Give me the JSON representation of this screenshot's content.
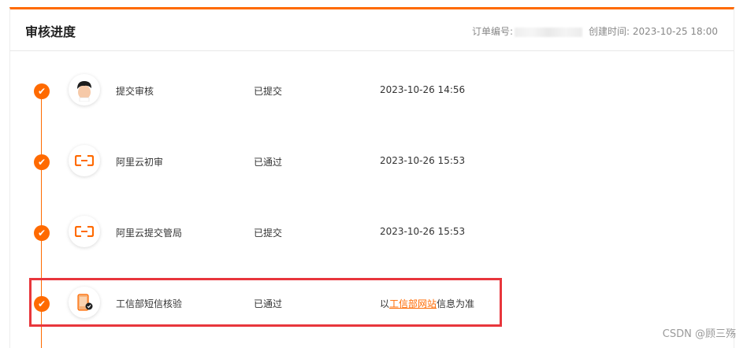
{
  "header": {
    "title": "审核进度",
    "order_label": "订单编号:",
    "created_label": "创建时间: 2023-10-25 18:00"
  },
  "steps": [
    {
      "name": "提交审核",
      "status": "已提交",
      "time": "2023-10-26 14:56",
      "icon": "person-avatar-icon"
    },
    {
      "name": "阿里云初审",
      "status": "已通过",
      "time": "2023-10-26 15:53",
      "icon": "aliyun-logo-icon"
    },
    {
      "name": "阿里云提交管局",
      "status": "已提交",
      "time": "2023-10-26 15:53",
      "icon": "aliyun-logo-icon"
    },
    {
      "name": "工信部短信核验",
      "status": "已通过",
      "time_prefix": "以",
      "time_link": "工信部网站",
      "time_suffix": "信息为准",
      "icon": "phone-verify-icon"
    }
  ],
  "colors": {
    "accent": "#ff6a00",
    "highlight": "#e8363c"
  },
  "watermark": "CSDN @顾三殇"
}
